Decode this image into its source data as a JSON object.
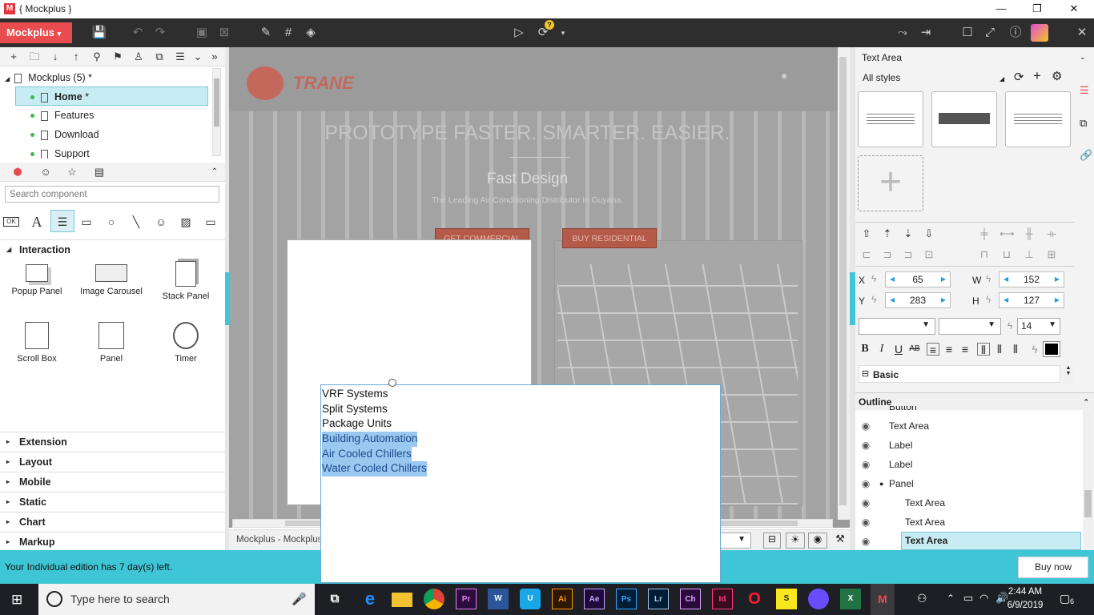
{
  "window": {
    "title": "{ Mockplus }",
    "icon": "M"
  },
  "brand": {
    "label": "Mockplus"
  },
  "project": {
    "root": "Mockplus (5)",
    "pages": [
      {
        "name": "Home",
        "selected": true
      },
      {
        "name": "Features"
      },
      {
        "name": "Download"
      },
      {
        "name": "Support"
      }
    ]
  },
  "components": {
    "search_placeholder": "Search component",
    "ok_label": "OK",
    "a_label": "A",
    "interaction": "Interaction",
    "items": [
      "Popup Panel",
      "Image Carousel",
      "Stack Panel",
      "Scroll Box",
      "Panel",
      "Timer"
    ],
    "sections": [
      "Extension",
      "Layout",
      "Mobile",
      "Static",
      "Chart",
      "Markup"
    ]
  },
  "canvas": {
    "logo": "TRANE",
    "headline": "PROTOTYPE FASTER. SMARTER. EASIER.",
    "subheadline": "Fast Design",
    "tagline": "The Leading Air Conditioning Distributor in Guyana.",
    "btn_commercial": "GET COMMERCIAL",
    "btn_residential": "BUY RESIDENTIAL"
  },
  "popup_lines": [
    {
      "text": "VRF Systems",
      "highlight": false
    },
    {
      "text": "Split Systems",
      "highlight": false
    },
    {
      "text": "Package Units",
      "highlight": false
    },
    {
      "text": "Building Automation",
      "highlight": true
    },
    {
      "text": "Air Cooled Chillers",
      "highlight": true
    },
    {
      "text": "Water Cooled Chillers",
      "highlight": true
    }
  ],
  "properties": {
    "component_type": "Text Area",
    "styles_label": "All styles",
    "x_label": "X",
    "x": "65",
    "y_label": "Y",
    "y": "283",
    "w_label": "W",
    "w": "152",
    "h_label": "H",
    "h": "127",
    "font_size": "14",
    "basic": "Basic",
    "bold": "B",
    "italic": "I",
    "underline": "U",
    "strike": "AB"
  },
  "outline": {
    "title": "Outline",
    "items": [
      {
        "name": "Text Area",
        "indent": 0
      },
      {
        "name": "Label",
        "indent": 0
      },
      {
        "name": "Label",
        "indent": 0
      },
      {
        "name": "Panel",
        "indent": 0
      },
      {
        "name": "Text Area",
        "indent": 1
      },
      {
        "name": "Text Area",
        "indent": 1
      },
      {
        "name": "Text Area",
        "indent": 1,
        "selected": true
      }
    ]
  },
  "bottom": {
    "tab": "Mockplus - Mockplus"
  },
  "status": {
    "message": "Your Individual edition has 7 day(s) left.",
    "buy": "Buy now"
  },
  "taskbar": {
    "search_placeholder": "Type here to search",
    "apps": [
      "Pr",
      "W",
      "U",
      "Ai",
      "Ae",
      "Ps",
      "Lr",
      "Ch",
      "Id",
      "O",
      "S",
      "X",
      "M"
    ],
    "time": "2:44 AM",
    "date": "6/9/2019",
    "notif_count": "6"
  },
  "colors": {
    "brand": "#e84c4e",
    "accent": "#3fc6d6",
    "toolbar": "#2e2e2e"
  }
}
